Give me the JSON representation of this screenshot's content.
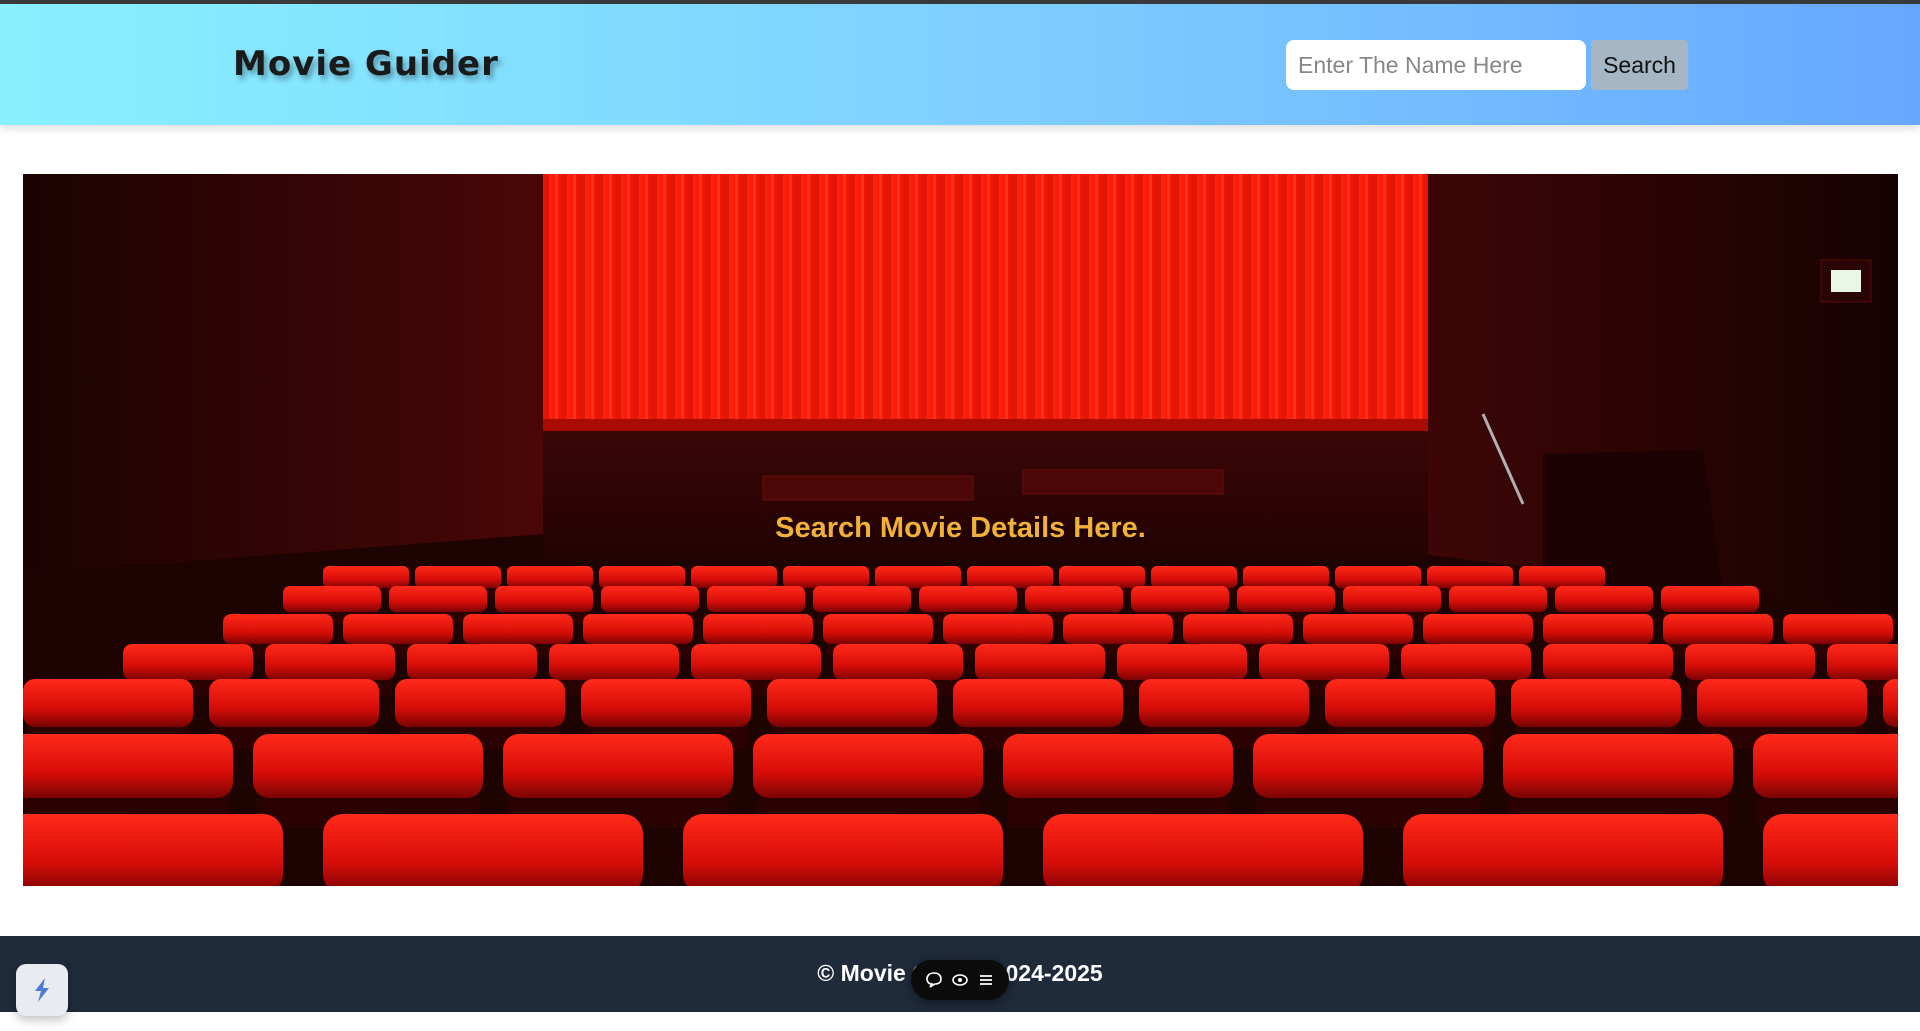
{
  "header": {
    "brand": "Movie Guider",
    "search": {
      "placeholder": "Enter The Name Here",
      "value": "",
      "button_label": "Search"
    }
  },
  "hero": {
    "title": "Search Movie Details Here."
  },
  "footer": {
    "text": "© Movie Guider 2024-2025"
  },
  "floating_toolbar": {
    "icons": [
      "comment-icon",
      "eye-icon",
      "menu-icon"
    ]
  },
  "corner_widget": {
    "icon": "lightning-logo-icon"
  },
  "colors": {
    "header_gradient_start": "#88f0ff",
    "header_gradient_end": "#66a8ff",
    "hero_title": "#f3b038",
    "footer_bg": "#1f2a3b",
    "seat_red": "#e01010",
    "curtain_red": "#ff1a0a"
  }
}
